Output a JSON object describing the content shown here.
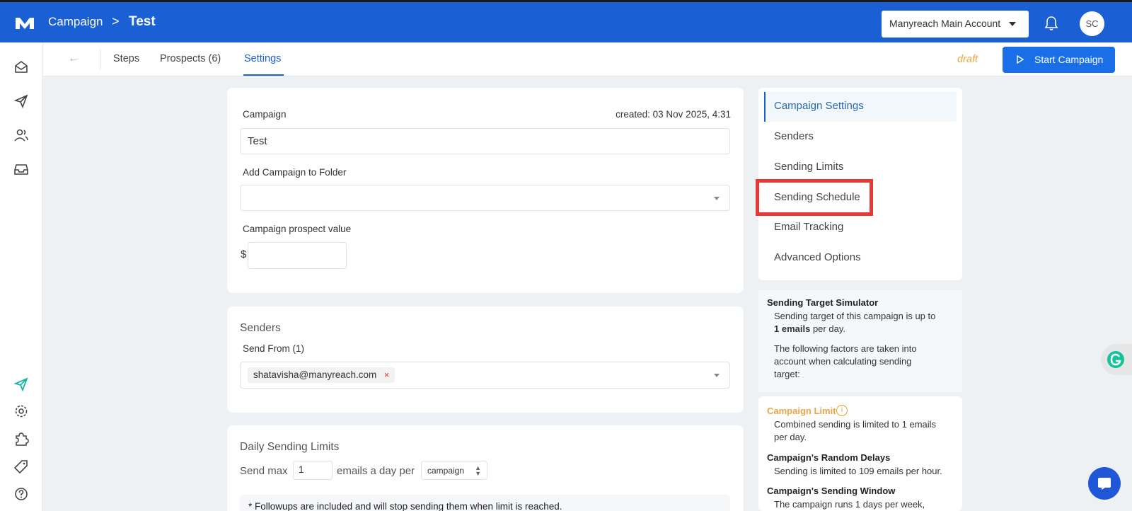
{
  "topbar": {
    "breadcrumb_root": "Campaign",
    "breadcrumb_sep": ">",
    "campaign_name": "Test",
    "account_selector": "Manyreach Main Account",
    "avatar_initials": "SC",
    "bg_color": "#1a5fd4"
  },
  "subnav": {
    "back": "←",
    "tabs": [
      "Steps",
      "Prospects (6)",
      "Settings"
    ],
    "active_tab": "Settings",
    "status": "draft",
    "start_button": "Start Campaign"
  },
  "campaign_card": {
    "campaign_label": "Campaign",
    "created": "created: 03 Nov 2025, 4:31",
    "campaign_value": "Test",
    "folder_label": "Add Campaign to Folder",
    "folder_value": "",
    "prospect_value_label": "Campaign prospect value",
    "currency": "$",
    "prospect_value": ""
  },
  "senders_card": {
    "title": "Senders",
    "send_from_label": "Send From (1)",
    "sender_tag": "shatavisha@manyreach.com",
    "remove": "×"
  },
  "limits_card": {
    "title": "Daily Sending Limits",
    "send_max": "Send max",
    "max_value": "1",
    "emails_a_day_per": "emails a day per",
    "per_value": "campaign",
    "note": "* Followups are included and will stop sending them when limit is reached."
  },
  "settings_nav": {
    "items": [
      "Campaign Settings",
      "Senders",
      "Sending Limits",
      "Sending Schedule",
      "Email Tracking",
      "Advanced Options"
    ],
    "active": "Campaign Settings",
    "highlighted": "Sending Schedule"
  },
  "simulator": {
    "title": "Sending Target Simulator",
    "line1": "Sending target of this campaign is up to",
    "line2_bold": "1 emails",
    "line2_rest": "per day.",
    "line3": "The following factors are taken into",
    "line4": "account when calculating sending",
    "line5": "target:"
  },
  "factors": {
    "campaign_limit_title": "Campaign Limit",
    "campaign_limit_l1": "Combined sending is limited to 1 emails",
    "campaign_limit_l2": "per day.",
    "random_delays_title": "Campaign's Random Delays",
    "random_delays_text": "Sending is limited to 109 emails per hour.",
    "window_title": "Campaign's Sending Window",
    "window_text": "The campaign runs 1 days per week,"
  },
  "colors": {
    "primary": "#1a5fd4",
    "start_button": "#1a6fe8",
    "draft": "#e8a64a",
    "highlight_box": "#e53935",
    "campaign_limit": "#e8a64a"
  },
  "icons": {
    "logo": "manyreach-logo-icon",
    "bell": "bell-icon",
    "rail": [
      "mail-icon",
      "send-icon",
      "users-icon",
      "inbox-icon",
      "send-active-icon",
      "gear-icon",
      "puzzle-icon",
      "tag-icon",
      "help-icon"
    ]
  }
}
